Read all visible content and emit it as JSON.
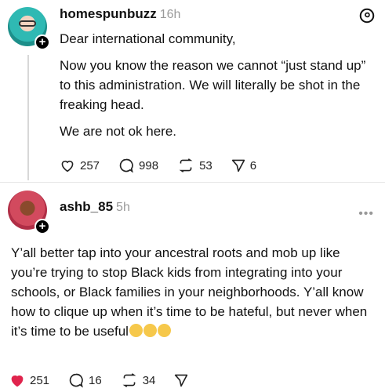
{
  "post1": {
    "username": "homespunbuzz",
    "time": "16h",
    "paragraphs": [
      "Dear international community,",
      "Now you know the reason we cannot “just stand up” to this administration. We will literally be shot in the freaking head.",
      "We are not ok here."
    ],
    "stats": {
      "likes": "257",
      "replies": "998",
      "reposts": "53",
      "shares": "6"
    }
  },
  "post2": {
    "username": "ashb_85",
    "time": "5h",
    "body": "Y’all better tap into your ancestral roots and mob up like you’re trying to stop Black kids from integrating into your schools, or Black families in your neighborhoods. Y’all know how to clique up when it’s time to be hateful, but never when it’s time to be useful",
    "stats": {
      "likes": "251",
      "replies": "16",
      "reposts": "34"
    }
  },
  "colors": {
    "like_active": "#e0244d",
    "muted": "#9a9a9a"
  },
  "icons": [
    "threads-logo-icon",
    "heart-icon",
    "comment-icon",
    "repost-icon",
    "share-icon",
    "more-icon",
    "plus-icon"
  ]
}
